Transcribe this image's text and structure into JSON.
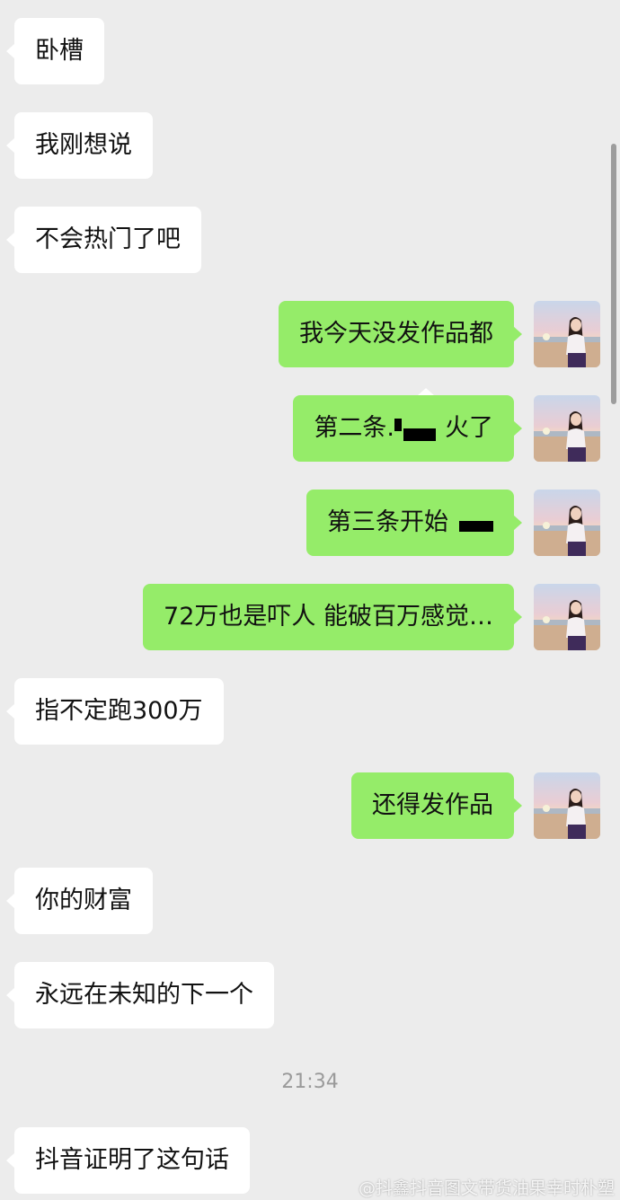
{
  "messages": [
    {
      "side": "left",
      "text": "卧槽"
    },
    {
      "side": "left",
      "text": "我刚想说"
    },
    {
      "side": "left",
      "text": "不会热门了吧"
    },
    {
      "side": "right",
      "text": "我今天没发作品都"
    },
    {
      "side": "right",
      "text_before": "第二条.",
      "text_after": "火了"
    },
    {
      "side": "right",
      "text_before": "第三条开始"
    },
    {
      "side": "right",
      "text": "72万也是吓人 能破百万感觉…"
    },
    {
      "side": "left",
      "text": "指不定跑300万"
    },
    {
      "side": "right",
      "text": "还得发作品"
    },
    {
      "side": "left",
      "text": "你的财富"
    },
    {
      "side": "left",
      "text": "永远在未知的下一个"
    },
    {
      "side": "left",
      "text": "抖音证明了这句话"
    }
  ],
  "timestamp": "21:34",
  "watermark": "@抖鑫抖音图文带货油果幸时朴塑",
  "colors": {
    "background": "#ececec",
    "incoming_bubble": "#ffffff",
    "outgoing_bubble": "#95ec69",
    "timestamp_text": "#9a9a9a"
  },
  "icons": {
    "avatar": "beach-girl-avatar-photo"
  }
}
